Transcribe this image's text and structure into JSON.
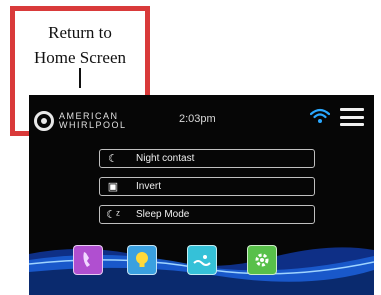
{
  "annotation": {
    "line1": "Return to",
    "line2": "Home Screen"
  },
  "header": {
    "brand_line1": "AMERICAN",
    "brand_line2": "WHIRLPOOL",
    "time": "2:03pm"
  },
  "menu": {
    "items": [
      {
        "label": "Night contast",
        "icon": "moon-icon"
      },
      {
        "label": "Invert",
        "icon": "invert-icon"
      },
      {
        "label": "Sleep Mode",
        "icon": "sleep-icon"
      }
    ]
  },
  "dock": {
    "tiles": [
      {
        "icon": "phone-icon",
        "color": "#b04fd0"
      },
      {
        "icon": "lightbulb-icon",
        "color": "#3aa0e0"
      },
      {
        "icon": "spa-icon",
        "color": "#35c1d8"
      },
      {
        "icon": "gear-icon",
        "color": "#58c04a"
      }
    ]
  },
  "colors": {
    "callout_border": "#d93a3a",
    "wifi": "#2aa8ff",
    "wave": "#1b5fd6"
  }
}
